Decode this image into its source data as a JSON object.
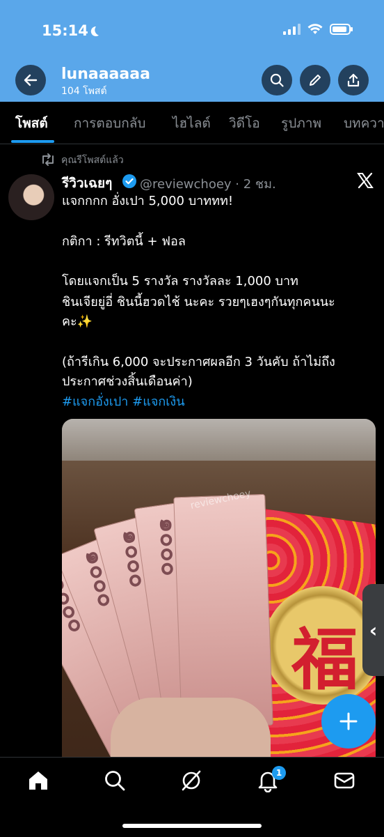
{
  "status_bar": {
    "time": "15:14"
  },
  "header": {
    "name": "lunaaaaaa",
    "post_count": "104 โพสต์"
  },
  "tabs": [
    {
      "label": "โพสต์",
      "active": true
    },
    {
      "label": "การตอบกลับ",
      "active": false
    },
    {
      "label": "ไฮไลต์",
      "active": false
    },
    {
      "label": "วิดีโอ",
      "active": false
    },
    {
      "label": "รูปภาพ",
      "active": false
    },
    {
      "label": "บทควา",
      "active": false
    }
  ],
  "tweet": {
    "repost_label": "คุณรีโพสต์แล้ว",
    "author_name": "รีวิวเฉยๆ",
    "handle": "@reviewchoey",
    "time": "2 ชม.",
    "lines": [
      "แจกกกก อั่งเปา  5,000 บาททท!",
      "กติกา : รีทวิตนี้ + ฟอล",
      "โดยแจกเป็น 5 รางวัล รางวัลละ 1,000 บาท",
      "ชินเจียยู่อี่ ชินนี้ฮวดไช้ นะคะ รวยๆเฮงๆกันทุกคนนะ",
      "คะ✨",
      "(ถ้ารีเกิน 6,000 จะประกาศผลอีก 3 วันคับ ถ้าไม่ถึง",
      "ประกาศช่วงสิ้นเดือนค่า)"
    ],
    "hashtags": "#แจกอั่งเปา #แจกเงิน",
    "image": {
      "watermark": "reviewchoey",
      "bill_label": "๑๐๐๐",
      "envelope_char": "福"
    }
  },
  "bottom_nav": {
    "items": [
      "home",
      "search",
      "grok",
      "notifications",
      "messages"
    ],
    "notification_badge": "1"
  },
  "colors": {
    "accent": "#1d9bf0",
    "header_bg": "#5aa7ea",
    "background": "#000000"
  }
}
